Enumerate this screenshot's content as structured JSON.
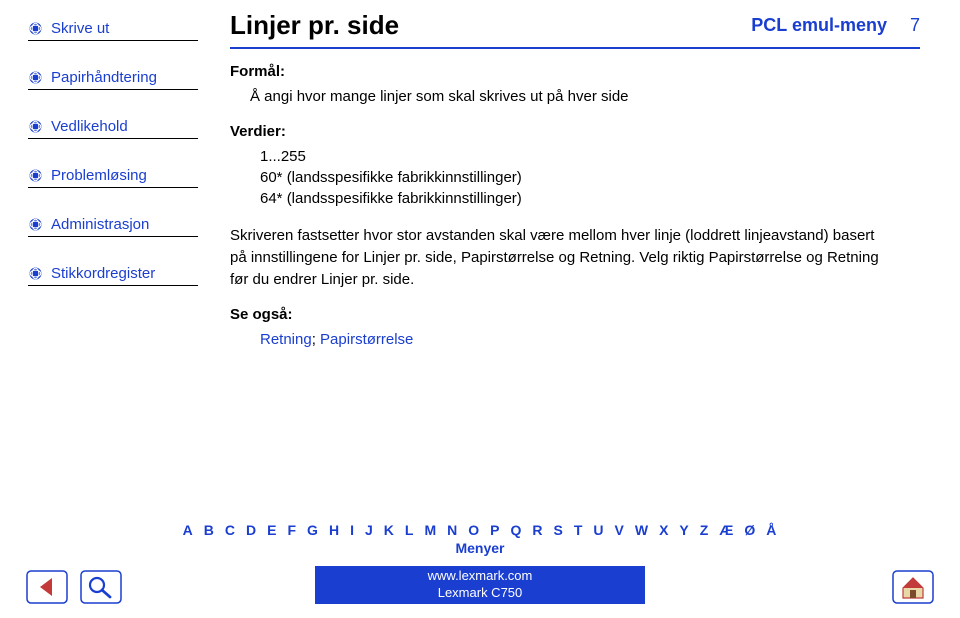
{
  "header": {
    "title": "Linjer pr. side",
    "section": "PCL emul-meny",
    "page_number": "7"
  },
  "sidebar": {
    "items": [
      {
        "label": "Skrive ut"
      },
      {
        "label": "Papirhåndtering"
      },
      {
        "label": "Vedlikehold"
      },
      {
        "label": "Problemløsing"
      },
      {
        "label": "Administrasjon"
      },
      {
        "label": "Stikkordregister"
      }
    ]
  },
  "content": {
    "purpose_label": "Formål:",
    "purpose_text": "Å angi hvor mange linjer som skal skrives ut på hver side",
    "values_label": "Verdier:",
    "values": {
      "range": "1...255",
      "line1": "60* (landsspesifikke fabrikkinnstillinger)",
      "line2": "64* (landsspesifikke fabrikkinnstillinger)"
    },
    "description": "Skriveren fastsetter hvor stor avstanden skal være mellom hver linje (loddrett linjeavstand) basert på innstillingene for Linjer pr. side, Papirstørrelse og Retning. Velg riktig Papirstørrelse og Retning før du endrer Linjer pr. side.",
    "see_also_label": "Se også:",
    "see_also": {
      "link1": "Retning",
      "sep": "; ",
      "link2": "Papirstørrelse"
    }
  },
  "footer": {
    "letters": [
      "A",
      "B",
      "C",
      "D",
      "E",
      "F",
      "G",
      "H",
      "I",
      "J",
      "K",
      "L",
      "M",
      "N",
      "O",
      "P",
      "Q",
      "R",
      "S",
      "T",
      "U",
      "V",
      "W",
      "X",
      "Y",
      "Z",
      "Æ",
      "Ø",
      "Å"
    ],
    "menus": "Menyer",
    "url": "www.lexmark.com",
    "product": "Lexmark C750"
  }
}
